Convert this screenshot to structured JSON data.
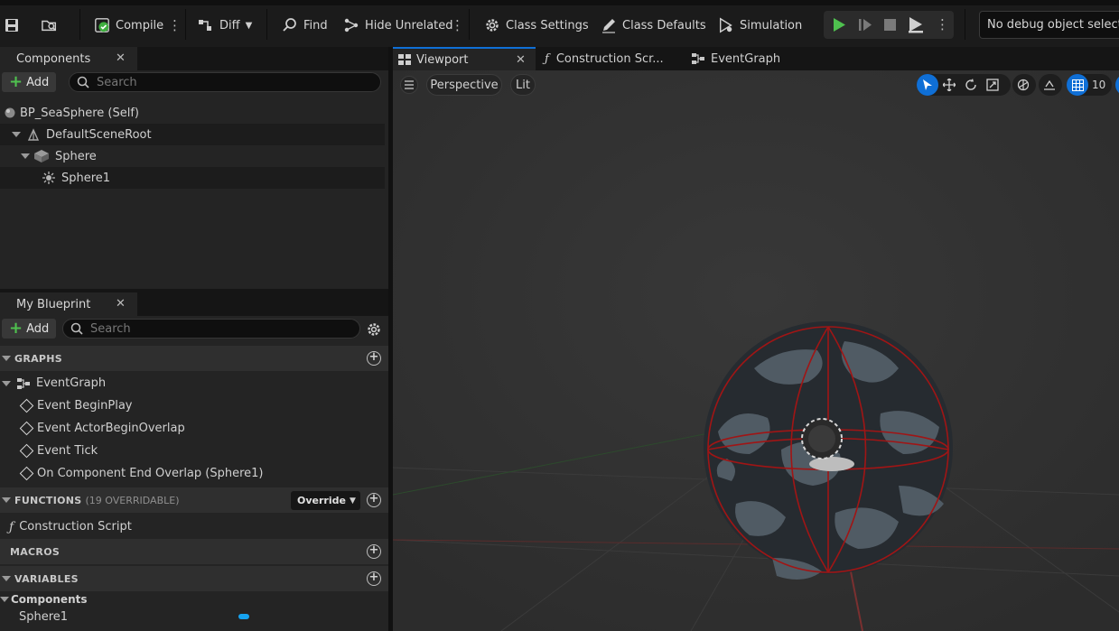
{
  "toolbar": {
    "compile_label": "Compile",
    "diff_label": "Diff",
    "find_label": "Find",
    "hide_unrelated_label": "Hide Unrelated",
    "class_settings_label": "Class Settings",
    "class_defaults_label": "Class Defaults",
    "simulation_label": "Simulation",
    "debug_object_label": "No debug object selected"
  },
  "components_panel": {
    "tab_label": "Components",
    "add_label": "Add",
    "search_placeholder": "Search",
    "tree": [
      {
        "label": "BP_SeaSphere (Self)"
      },
      {
        "label": "DefaultSceneRoot"
      },
      {
        "label": "Sphere"
      },
      {
        "label": "Sphere1"
      }
    ]
  },
  "my_blueprint": {
    "tab_label": "My Blueprint",
    "add_label": "Add",
    "search_placeholder": "Search",
    "graphs_header": "GRAPHS",
    "event_graph_label": "EventGraph",
    "events": [
      {
        "label": "Event BeginPlay"
      },
      {
        "label": "Event ActorBeginOverlap"
      },
      {
        "label": "Event Tick"
      },
      {
        "label": "On Component End Overlap (Sphere1)"
      }
    ],
    "functions_header": "FUNCTIONS",
    "functions_sub": "(19 OVERRIDABLE)",
    "override_label": "Override",
    "construction_script_label": "Construction Script",
    "macros_header": "MACROS",
    "variables_header": "VARIABLES",
    "variables_category": "Components",
    "variable_item": "Sphere1"
  },
  "editor_tabs": {
    "viewport_label": "Viewport",
    "construction_label": "Construction Scr...",
    "eventgraph_label": "EventGraph"
  },
  "viewport": {
    "perspective_label": "Perspective",
    "lit_label": "Lit",
    "grid_snap_value": "10"
  },
  "colors": {
    "accent_blue": "#0f6fd6",
    "play_green": "#4fc14f",
    "collision_red": "#a01515",
    "variable_blue": "#16a3f0"
  }
}
